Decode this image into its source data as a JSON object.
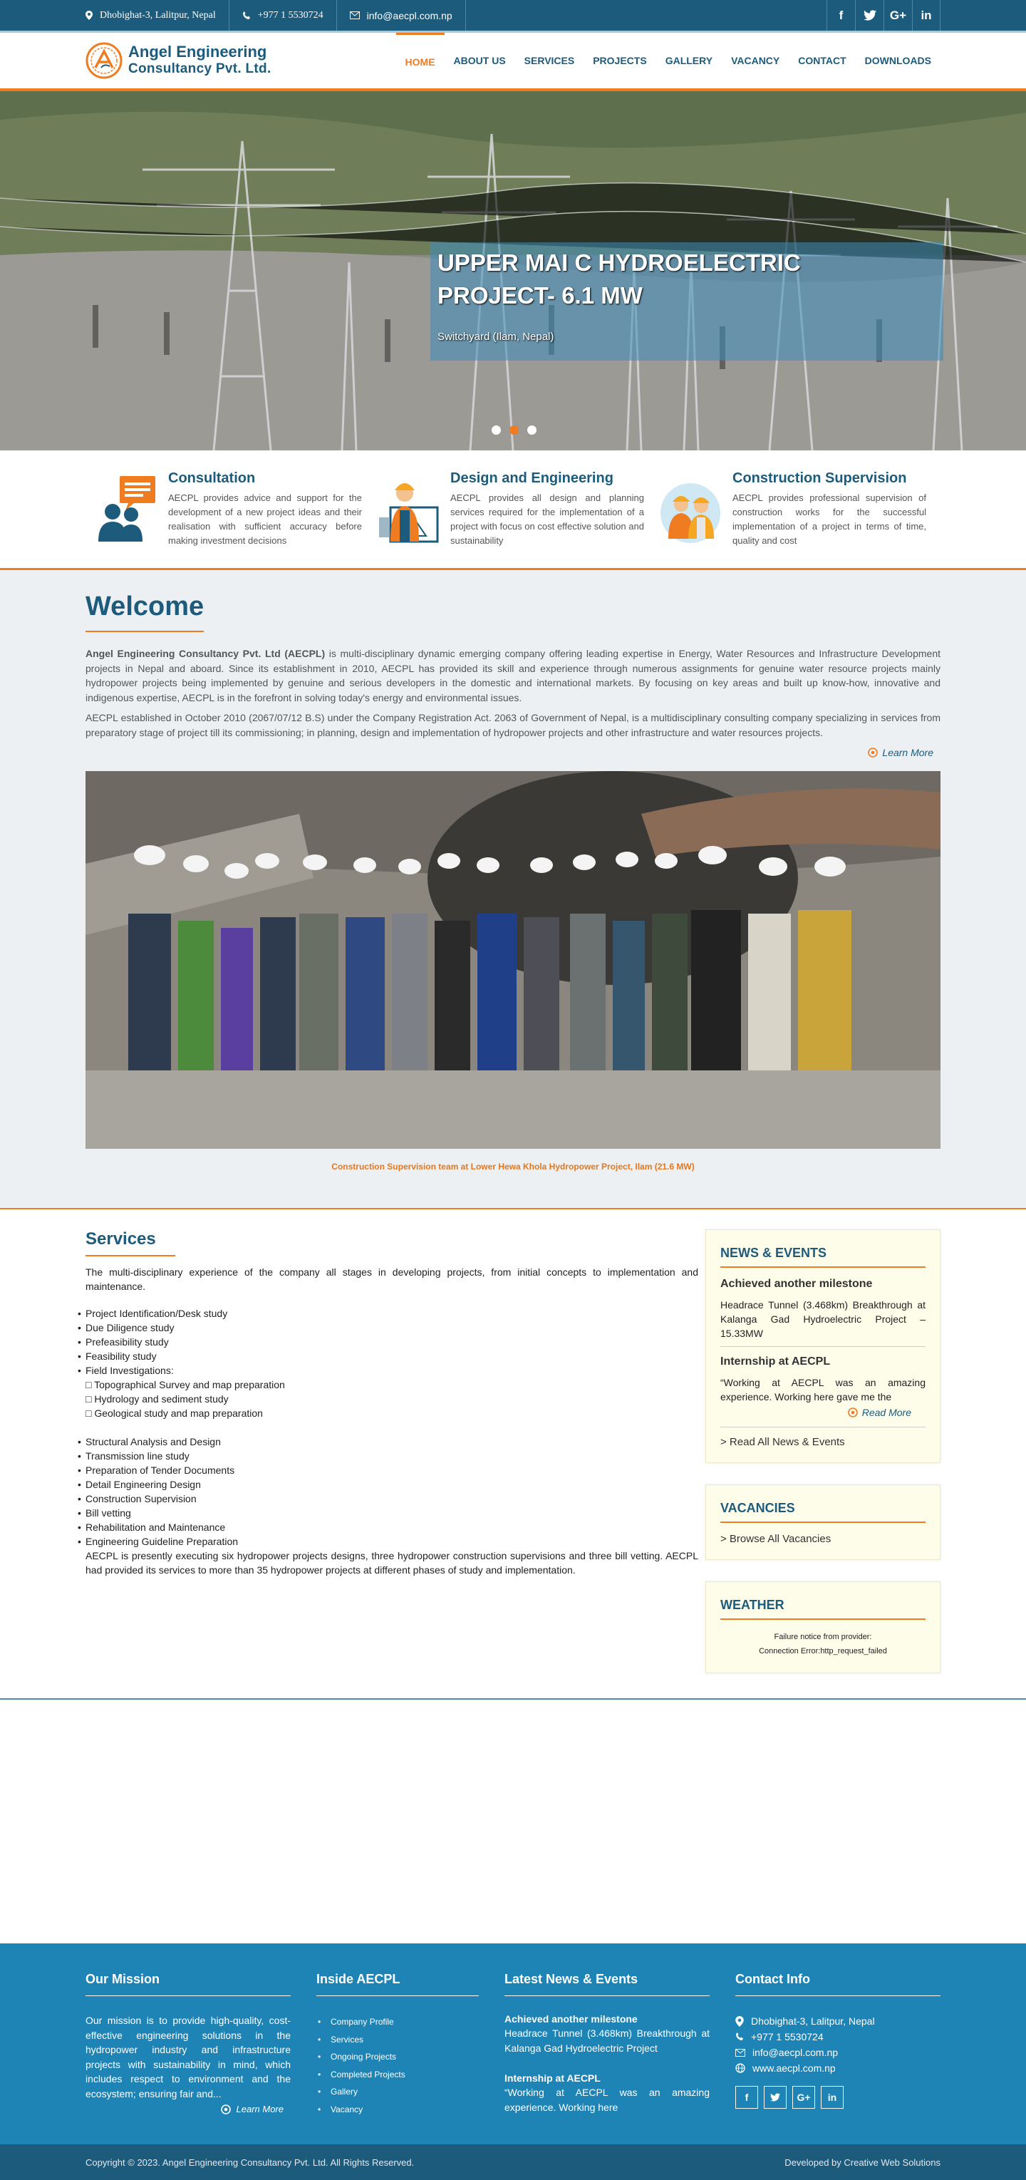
{
  "topbar": {
    "address": "Dhobighat-3, Lalitpur, Nepal",
    "phone": "+977 1 5530724",
    "email": "info@aecpl.com.np",
    "social": [
      "f",
      "t",
      "G+",
      "in"
    ]
  },
  "logo": {
    "line1": "Angel Engineering",
    "line2": "Consultancy Pvt. Ltd."
  },
  "nav": [
    "HOME",
    "ABOUT US",
    "SERVICES",
    "PROJECTS",
    "GALLERY",
    "VACANCY",
    "CONTACT",
    "DOWNLOADS"
  ],
  "hero": {
    "title": "UPPER MAI C HYDROELECTRIC PROJECT- 6.1 MW",
    "subtitle": "Switchyard (Ilam, Nepal)",
    "active_slide": 2,
    "slide_count": 3
  },
  "features": [
    {
      "title": "Consultation",
      "text": "AECPL provides advice and support for the development of a new project ideas and their realisation with sufficient accuracy before making investment decisions",
      "icon": "consultation-icon"
    },
    {
      "title": "Design and Engineering",
      "text": "AECPL provides all design and planning services required for the implementation of a project with focus on cost effective solution and sustainability",
      "icon": "engineer-icon"
    },
    {
      "title": "Construction Supervision",
      "text": "AECPL provides professional supervision of construction works for the successful implementation of a project in terms of time, quality and cost",
      "icon": "supervision-icon"
    }
  ],
  "welcome": {
    "title": "Welcome",
    "company": "Angel Engineering Consultancy Pvt. Ltd (AECPL)",
    "para1": " is multi-disciplinary dynamic emerging company offering leading expertise in Energy, Water Resources and Infrastructure Development projects in Nepal and aboard. Since its establishment in 2010, AECPL has provided its skill and experience through numerous assignments for genuine water resource projects mainly hydropower projects being implemented by genuine and serious developers in the domestic and international markets. By focusing on key areas and built up know-how, innovative and indigenous expertise, AECPL is in the forefront in solving today's energy and environmental issues.",
    "para2": "AECPL established in October 2010 (2067/07/12 B.S) under the Company Registration Act. 2063 of Government of Nepal, is a multidisciplinary consulting company specializing in services from preparatory stage of project till its commissioning; in planning, design and implementation of hydropower projects and other infrastructure and water resources projects.",
    "learn_more": "Learn More",
    "photo_caption": "Construction Supervision team at Lower Hewa Khola Hydropower Project, Ilam (21.6 MW)"
  },
  "services": {
    "title": "Services",
    "intro": "The multi-disciplinary experience of the company all stages in developing projects, from initial concepts to implementation and maintenance.",
    "list1": [
      "Project Identification/Desk study",
      "Due Diligence study",
      "Prefeasibility study",
      "Feasibility study",
      "Field Investigations:"
    ],
    "sublist": [
      "□ Topographical Survey and map preparation",
      "□ Hydrology and sediment study",
      "□ Geological study and map preparation"
    ],
    "list2": [
      "Structural Analysis and Design",
      "Transmission line study",
      "Preparation of Tender Documents",
      "Detail Engineering Design",
      "Construction Supervision",
      "Bill vetting",
      "Rehabilitation and Maintenance",
      "Engineering Guideline Preparation"
    ],
    "outro": "AECPL is presently executing six hydropower projects designs, three hydropower construction supervisions and three bill vetting. AECPL had provided its services to more than 35 hydropower projects at different phases of study and implementation."
  },
  "sidebar": {
    "news_title": "NEWS & EVENTS",
    "news1_title": "Achieved another milestone",
    "news1_text": "Headrace Tunnel (3.468km) Breakthrough at Kalanga Gad Hydroelectric Project – 15.33MW",
    "news2_title": "Internship at AECPL",
    "news2_text": "“Working at AECPL was an amazing experience. Working here gave me the",
    "read_more": "Read More",
    "read_all": "> Read All News & Events",
    "vac_title": "VACANCIES",
    "vac_link": "> Browse All Vacancies",
    "weather_title": "WEATHER",
    "weather_l1": "Failure notice from provider:",
    "weather_l2": "Connection Error:http_request_failed"
  },
  "footer": {
    "mission_title": "Our Mission",
    "mission_text": "Our mission is to provide high-quality, cost-effective engineering solutions in the hydropower industry and infrastructure projects with sustainability in mind, which includes respect to environment and the ecosystem; ensuring fair and...",
    "learn_more": "Learn More",
    "inside_title": "Inside AECPL",
    "inside_links": [
      "Company Profile",
      "Services",
      "Ongoing Projects",
      "Completed Projects",
      "Gallery",
      "Vacancy"
    ],
    "news_title": "Latest News & Events",
    "news1_title": "Achieved another milestone",
    "news1_text": "Headrace Tunnel (3.468km) Breakthrough at Kalanga Gad Hydroelectric Project",
    "news2_title": "Internship at AECPL",
    "news2_text": "“Working at AECPL was an amazing experience. Working here",
    "contact_title": "Contact Info",
    "address": "Dhobighat-3, Lalitpur, Nepal",
    "phone": "+977 1 5530724",
    "email": "info@aecpl.com.np",
    "web": "www.aecpl.com.np",
    "social": [
      "f",
      "t",
      "G+",
      "in"
    ]
  },
  "copyright": {
    "left": "Copyright © 2023. Angel Engineering Consultancy Pvt. Ltd. All Rights Reserved.",
    "right": "Developed by Creative Web Solutions"
  },
  "colors": {
    "brand": "#1d5b7d",
    "accent": "#f07c21",
    "footer": "#1d84b5"
  }
}
